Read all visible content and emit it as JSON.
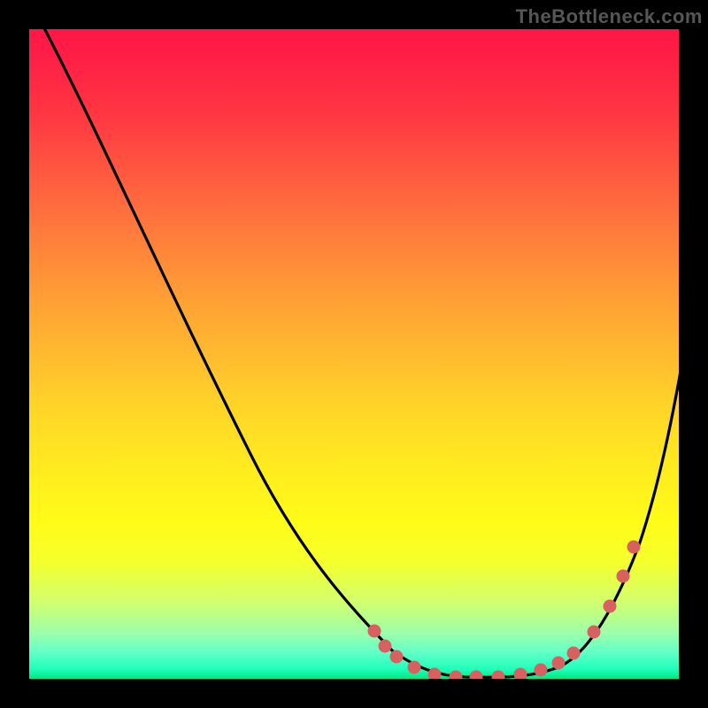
{
  "watermark": "TheBottleneck.com",
  "chart_data": {
    "type": "line",
    "title": "",
    "xlabel": "",
    "ylabel": "",
    "xlim": [
      0,
      100
    ],
    "ylim": [
      0,
      100
    ],
    "background_gradient": {
      "direction": "top-to-bottom",
      "stops": [
        {
          "pos": 0,
          "color": "#ff1846"
        },
        {
          "pos": 50,
          "color": "#ffd428"
        },
        {
          "pos": 80,
          "color": "#fffc18"
        },
        {
          "pos": 100,
          "color": "#00e880"
        }
      ],
      "meaning": "y≈100 is worst (red), y≈0 is best (green)"
    },
    "series": [
      {
        "name": "bottleneck-curve",
        "color": "#000000",
        "x": [
          2,
          10,
          20,
          30,
          40,
          50,
          54,
          58,
          62,
          66,
          70,
          74,
          78,
          82,
          86,
          90,
          94,
          98,
          100
        ],
        "y": [
          100,
          84,
          66,
          48,
          32,
          18,
          11,
          6,
          3,
          1,
          0,
          0,
          1,
          3,
          7,
          16,
          28,
          42,
          49
        ]
      }
    ],
    "markers": {
      "name": "highlighted-range",
      "color": "#d86060",
      "radius": 7.5,
      "points_x": [
        53,
        55,
        57,
        59,
        62,
        66,
        69,
        72,
        76,
        79,
        82,
        84,
        87,
        89,
        91,
        93
      ],
      "points_y": [
        7,
        5,
        3,
        2,
        1,
        0,
        0,
        0,
        0,
        1,
        2,
        3,
        7,
        11,
        16,
        20
      ]
    }
  }
}
